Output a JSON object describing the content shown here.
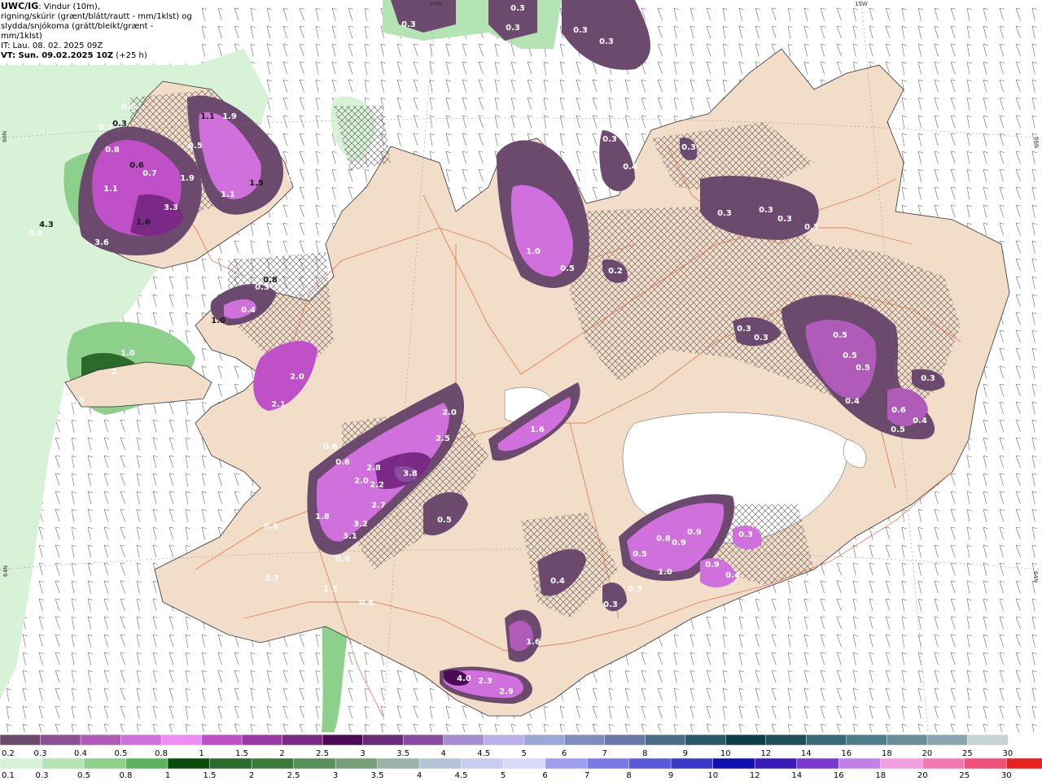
{
  "header": {
    "model_code": "UWC/IG",
    "desc_1": ": Vindur (10m),",
    "desc_2": "rigning/skúrir (grænt/blátt/rautt - mm/1klst) og",
    "desc_3": "slydda/snjókoma (grátt/bleikt/grænt - mm/1klst)",
    "issue_time": "IT: Lau. 08. 02. 2025 09Z",
    "valid_time_bold": "VT: Sun. 09.02.2025 10Z",
    "valid_time_offset": " (+25 h)"
  },
  "grid_labels": {
    "lon_20w": "20W",
    "lon_15w": "15W",
    "lat_66n_left": "66N",
    "lat_66n_right": "66N",
    "lat_64n_left": "64N",
    "lat_64n_right": "64N"
  },
  "legend_snow": {
    "labels": [
      "0.2",
      "0.3",
      "0.4",
      "0.5",
      "0.8",
      "1",
      "1.5",
      "2",
      "2.5",
      "3",
      "3.5",
      "4",
      "4.5",
      "5",
      "6",
      "7",
      "8",
      "9",
      "10",
      "12",
      "14",
      "16",
      "18",
      "20",
      "25",
      "30"
    ],
    "colors": [
      "#6b4a6e",
      "#8c4f93",
      "#b05ab9",
      "#d070dc",
      "#f08cf8",
      "#c050c8",
      "#9a3aa6",
      "#7a2a86",
      "#4a0a55",
      "#6a2a7a",
      "#8a4ca0",
      "#a48cd0",
      "#b8b0e8",
      "#9aa8d8",
      "#7e8cc0",
      "#6a78a8",
      "#4a6e86",
      "#2a5a6a",
      "#0e3e4a",
      "#1e4e5a",
      "#3a6a78",
      "#4e7e8a",
      "#6a8e98",
      "#8aa6ae",
      "#c6d4d6"
    ]
  },
  "legend_rain": {
    "labels": [
      "0.1",
      "0.3",
      "0.5",
      "0.8",
      "1",
      "1.5",
      "2",
      "2.5",
      "3",
      "3.5",
      "4",
      "4.5",
      "5",
      "6",
      "7",
      "8",
      "9",
      "10",
      "12",
      "14",
      "16",
      "18",
      "20",
      "25",
      "30"
    ],
    "colors": [
      "#d8f2d8",
      "#b4e4b4",
      "#8cd08c",
      "#5eb45e",
      "#0a4a0a",
      "#2a6a2a",
      "#3c7a3c",
      "#5a8e5a",
      "#78a078",
      "#98b4a8",
      "#b4c4d4",
      "#c8ccf0",
      "#d8d8fa",
      "#9e9ef0",
      "#7a7ae4",
      "#5a5ad8",
      "#3a3ac8",
      "#1010b0",
      "#3a1ab8",
      "#7a3ad0",
      "#c080e8",
      "#f0a0e0",
      "#f478b4",
      "#f0507a",
      "#e82020"
    ]
  },
  "values": [
    {
      "t": "0.3"
    },
    {
      "t": "0.3"
    },
    {
      "t": "0.3"
    },
    {
      "t": "0.3"
    },
    {
      "t": "0.3"
    },
    {
      "t": "0.6"
    },
    {
      "t": "0.3"
    },
    {
      "t": "0.8"
    },
    {
      "t": "0.5"
    },
    {
      "t": "0.6"
    },
    {
      "t": "0.7"
    },
    {
      "t": "1.9"
    },
    {
      "t": "1.1"
    },
    {
      "t": "1.9"
    },
    {
      "t": "1.1"
    },
    {
      "t": "1.5"
    },
    {
      "t": "0.3"
    },
    {
      "t": "1.1"
    },
    {
      "t": "1.6"
    },
    {
      "t": "3.3"
    },
    {
      "t": "3.6"
    },
    {
      "t": "4.3"
    },
    {
      "t": "0.9"
    },
    {
      "t": "0.7"
    },
    {
      "t": "0.8"
    },
    {
      "t": "0.3"
    },
    {
      "t": "0.4"
    },
    {
      "t": "1.0"
    },
    {
      "t": "1.0"
    },
    {
      "t": "2"
    },
    {
      "t": "3.5"
    },
    {
      "t": "2.0"
    },
    {
      "t": "2.1"
    },
    {
      "t": "0.3"
    },
    {
      "t": "0.4"
    },
    {
      "t": "0.3"
    },
    {
      "t": "1.0"
    },
    {
      "t": "0.5"
    },
    {
      "t": "0.2"
    },
    {
      "t": "0.3"
    },
    {
      "t": "0.3"
    },
    {
      "t": "0.3"
    },
    {
      "t": "0.3"
    },
    {
      "t": "0.3"
    },
    {
      "t": "0.3"
    },
    {
      "t": "0.5"
    },
    {
      "t": "0.5"
    },
    {
      "t": "0.5"
    },
    {
      "t": "0.4"
    },
    {
      "t": "0.6"
    },
    {
      "t": "0.3"
    },
    {
      "t": "0.4"
    },
    {
      "t": "0.5"
    },
    {
      "t": "2.0"
    },
    {
      "t": "1.6"
    },
    {
      "t": "2.5"
    },
    {
      "t": "2.8"
    },
    {
      "t": "3.8"
    },
    {
      "t": "2.2"
    },
    {
      "t": "2.0"
    },
    {
      "t": "0.6"
    },
    {
      "t": "0.6"
    },
    {
      "t": "2.7"
    },
    {
      "t": "3.2"
    },
    {
      "t": "3.1"
    },
    {
      "t": "1.8"
    },
    {
      "t": "0.5"
    },
    {
      "t": "0.6"
    },
    {
      "t": "0.7"
    },
    {
      "t": "0.6"
    },
    {
      "t": "1.3"
    },
    {
      "t": "0.8"
    },
    {
      "t": "0.8"
    },
    {
      "t": "0.8"
    },
    {
      "t": "0.9"
    },
    {
      "t": "0.5"
    },
    {
      "t": "0.9"
    },
    {
      "t": "1.0"
    },
    {
      "t": "0.9"
    },
    {
      "t": "0.4"
    },
    {
      "t": "0.3"
    },
    {
      "t": "0.3"
    },
    {
      "t": "0.4"
    },
    {
      "t": "0.3"
    },
    {
      "t": "1.6"
    },
    {
      "t": "4.0"
    },
    {
      "t": "2.3"
    },
    {
      "t": "2.9"
    }
  ]
}
